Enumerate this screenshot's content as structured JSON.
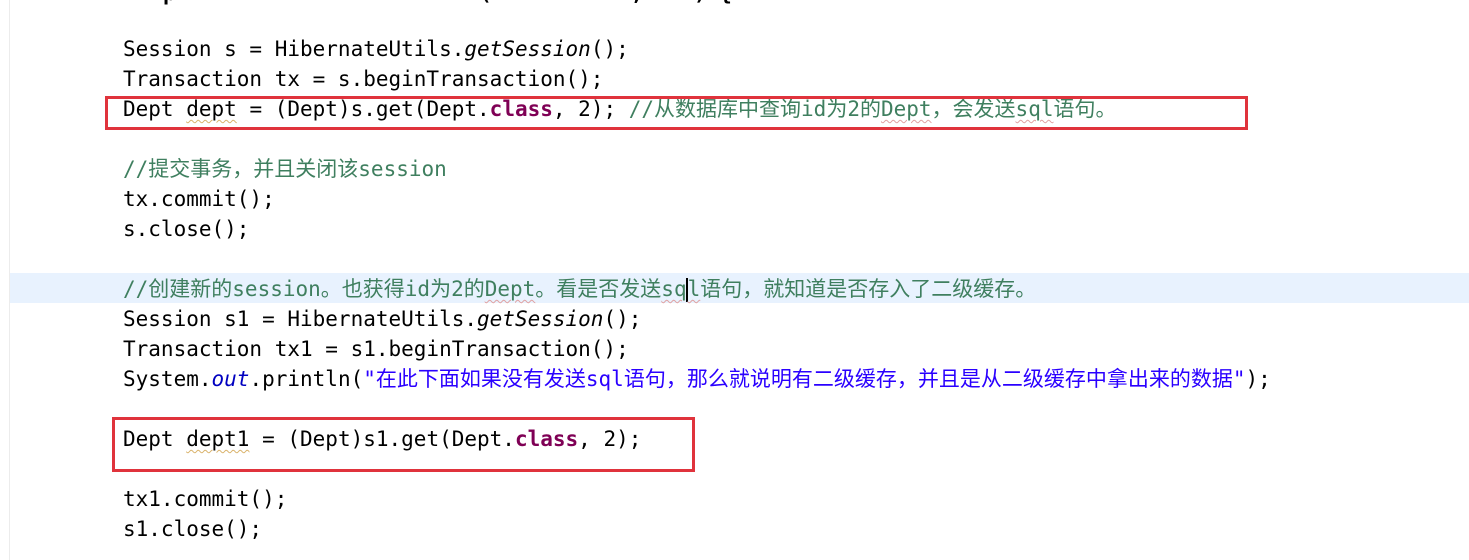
{
  "editor": {
    "partial_top_line": "p                   .    (           ,    ) {",
    "lines": [
      {
        "id": "l1",
        "segments": [
          {
            "text": "Session s = HibernateUtils.",
            "style": "plain"
          },
          {
            "text": "getSession",
            "style": "italic"
          },
          {
            "text": "();",
            "style": "plain"
          }
        ]
      },
      {
        "id": "l2",
        "segments": [
          {
            "text": "Transaction tx = s.beginTransaction();",
            "style": "plain"
          }
        ]
      },
      {
        "id": "l3",
        "segments": [
          {
            "text": "Dept ",
            "style": "plain"
          },
          {
            "text": "dept",
            "style": "warning"
          },
          {
            "text": " = (Dept)s.get(Dept.",
            "style": "plain"
          },
          {
            "text": "class",
            "style": "keyword"
          },
          {
            "text": ", 2); ",
            "style": "plain"
          },
          {
            "text": "//从数据库中查询id为2的",
            "style": "comment"
          },
          {
            "text": "Dept",
            "style": "comment-spell"
          },
          {
            "text": "，会发送",
            "style": "comment"
          },
          {
            "text": "sql",
            "style": "comment-spell"
          },
          {
            "text": "语句。",
            "style": "comment"
          }
        ]
      },
      {
        "id": "l4",
        "segments": [
          {
            "text": "//提交事务，并且关闭该session",
            "style": "comment"
          }
        ]
      },
      {
        "id": "l5",
        "segments": [
          {
            "text": "tx.commit();",
            "style": "plain"
          }
        ]
      },
      {
        "id": "l6",
        "segments": [
          {
            "text": "s.close();",
            "style": "plain"
          }
        ]
      },
      {
        "id": "l7",
        "segments": [
          {
            "text": "//创建新的session。也获得id为2的",
            "style": "comment"
          },
          {
            "text": "Dept",
            "style": "comment-spell"
          },
          {
            "text": "。看是否发送",
            "style": "comment"
          },
          {
            "text": "sq",
            "style": "comment-spell"
          },
          {
            "text": "",
            "style": "cursor"
          },
          {
            "text": "l",
            "style": "comment-spell"
          },
          {
            "text": "语句，就知道是否存入了二级缓存。",
            "style": "comment"
          }
        ]
      },
      {
        "id": "l8",
        "segments": [
          {
            "text": "Session s1 = HibernateUtils.",
            "style": "plain"
          },
          {
            "text": "getSession",
            "style": "italic"
          },
          {
            "text": "();",
            "style": "plain"
          }
        ]
      },
      {
        "id": "l9",
        "segments": [
          {
            "text": "Transaction tx1 = s1.beginTransaction();",
            "style": "plain"
          }
        ]
      },
      {
        "id": "l10",
        "segments": [
          {
            "text": "System.",
            "style": "plain"
          },
          {
            "text": "out",
            "style": "field"
          },
          {
            "text": ".println(",
            "style": "plain"
          },
          {
            "text": "\"在此下面如果没有发送sql语句，那么就说明有二级缓存，并且是从二级缓存中拿出来的数据\"",
            "style": "string"
          },
          {
            "text": ");",
            "style": "plain"
          }
        ]
      },
      {
        "id": "l11",
        "segments": [
          {
            "text": "Dept ",
            "style": "plain"
          },
          {
            "text": "dept1",
            "style": "warning"
          },
          {
            "text": " = (Dept)s1.get(Dept.",
            "style": "plain"
          },
          {
            "text": "class",
            "style": "keyword"
          },
          {
            "text": ", 2);",
            "style": "plain"
          }
        ]
      },
      {
        "id": "l12",
        "segments": [
          {
            "text": "tx1.commit();",
            "style": "plain"
          }
        ]
      },
      {
        "id": "l13",
        "segments": [
          {
            "text": "s1.close();",
            "style": "plain"
          }
        ]
      }
    ]
  },
  "annotations": {
    "box_color": "#e0333c",
    "boxes": [
      {
        "label": "first-get-highlight",
        "covers_line": "l3"
      },
      {
        "label": "second-get-highlight",
        "covers_line": "l11"
      }
    ]
  },
  "colors": {
    "keyword": "#7f0055",
    "comment": "#3f7f5f",
    "string": "#2a00ff",
    "field": "#0000c0",
    "current_line": "#e8f2fe"
  }
}
